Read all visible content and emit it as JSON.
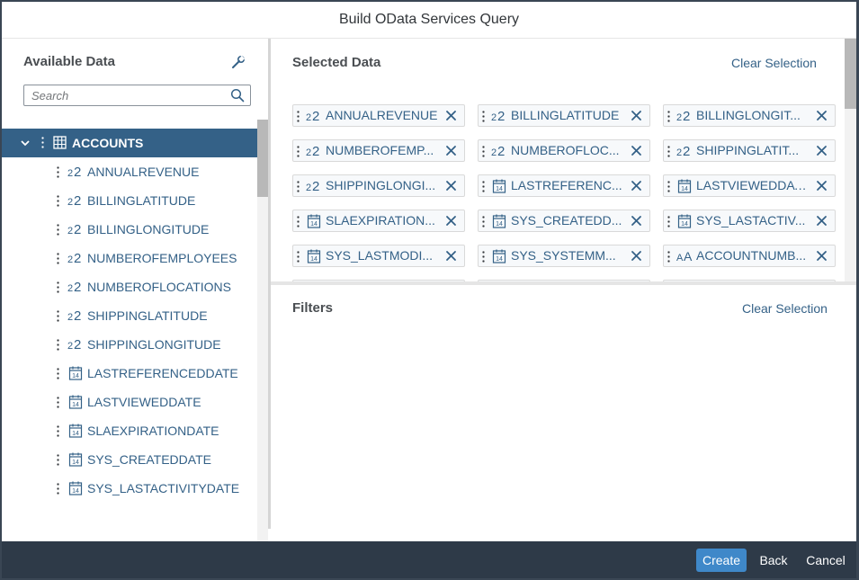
{
  "dialog": {
    "title": "Build OData Services Query"
  },
  "left": {
    "heading": "Available Data",
    "search_placeholder": "Search",
    "root": {
      "label": "ACCOUNTS",
      "icon": "table-icon"
    },
    "items": [
      {
        "label": "ANNUALREVENUE",
        "icon": "number-icon"
      },
      {
        "label": "BILLINGLATITUDE",
        "icon": "number-icon"
      },
      {
        "label": "BILLINGLONGITUDE",
        "icon": "number-icon"
      },
      {
        "label": "NUMBEROFEMPLOYEES",
        "icon": "number-icon"
      },
      {
        "label": "NUMBEROFLOCATIONS",
        "icon": "number-icon"
      },
      {
        "label": "SHIPPINGLATITUDE",
        "icon": "number-icon"
      },
      {
        "label": "SHIPPINGLONGITUDE",
        "icon": "number-icon"
      },
      {
        "label": "LASTREFERENCEDDATE",
        "icon": "calendar-icon"
      },
      {
        "label": "LASTVIEWEDDATE",
        "icon": "calendar-icon"
      },
      {
        "label": "SLAEXPIRATIONDATE",
        "icon": "calendar-icon"
      },
      {
        "label": "SYS_CREATEDDATE",
        "icon": "calendar-icon"
      },
      {
        "label": "SYS_LASTACTIVITYDATE",
        "icon": "calendar-icon"
      }
    ]
  },
  "selected": {
    "heading": "Selected Data",
    "clear_label": "Clear Selection",
    "tokens": [
      {
        "label": "ANNUALREVENUE",
        "icon": "number-icon"
      },
      {
        "label": "BILLINGLATITUDE",
        "icon": "number-icon"
      },
      {
        "label": "BILLINGLONGIT...",
        "icon": "number-icon"
      },
      {
        "label": "NUMBEROFEMP...",
        "icon": "number-icon"
      },
      {
        "label": "NUMBEROFLOC...",
        "icon": "number-icon"
      },
      {
        "label": "SHIPPINGLATIT...",
        "icon": "number-icon"
      },
      {
        "label": "SHIPPINGLONGI...",
        "icon": "number-icon"
      },
      {
        "label": "LASTREFERENC...",
        "icon": "calendar-icon"
      },
      {
        "label": "LASTVIEWEDDATE",
        "icon": "calendar-icon"
      },
      {
        "label": "SLAEXPIRATION...",
        "icon": "calendar-icon"
      },
      {
        "label": "SYS_CREATEDD...",
        "icon": "calendar-icon"
      },
      {
        "label": "SYS_LASTACTIV...",
        "icon": "calendar-icon"
      },
      {
        "label": "SYS_LASTMODI...",
        "icon": "calendar-icon"
      },
      {
        "label": "SYS_SYSTEMM...",
        "icon": "calendar-icon"
      },
      {
        "label": "ACCOUNTNUMB...",
        "icon": "text-icon"
      }
    ]
  },
  "filters": {
    "heading": "Filters",
    "clear_label": "Clear Selection"
  },
  "footer": {
    "create_label": "Create",
    "back_label": "Back",
    "cancel_label": "Cancel"
  },
  "icon_glyphs": {
    "number": "22",
    "calendar": "14",
    "text": "AA"
  }
}
